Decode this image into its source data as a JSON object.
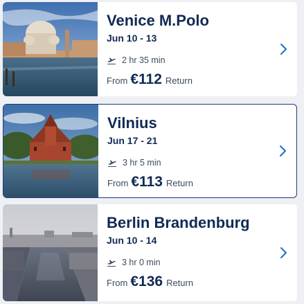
{
  "colors": {
    "title": "#102a54",
    "muted": "#3d4a5c",
    "accent": "#1a6fc9",
    "selected_border": "#1b3d7c"
  },
  "destinations": [
    {
      "city": "Venice M.Polo",
      "dates": "Jun 10 - 13",
      "duration": "2 hr 35 min",
      "from_label": "From",
      "price": "€112",
      "trip_type": "Return",
      "image": "venice-photo",
      "selected": false
    },
    {
      "city": "Vilnius",
      "dates": "Jun 17 - 21",
      "duration": "3 hr 5 min",
      "from_label": "From",
      "price": "€113",
      "trip_type": "Return",
      "image": "vilnius-photo",
      "selected": true
    },
    {
      "city": "Berlin Brandenburg",
      "dates": "Jun 10 - 14",
      "duration": "3 hr 0 min",
      "from_label": "From",
      "price": "€136",
      "trip_type": "Return",
      "image": "berlin-photo",
      "selected": false
    }
  ]
}
